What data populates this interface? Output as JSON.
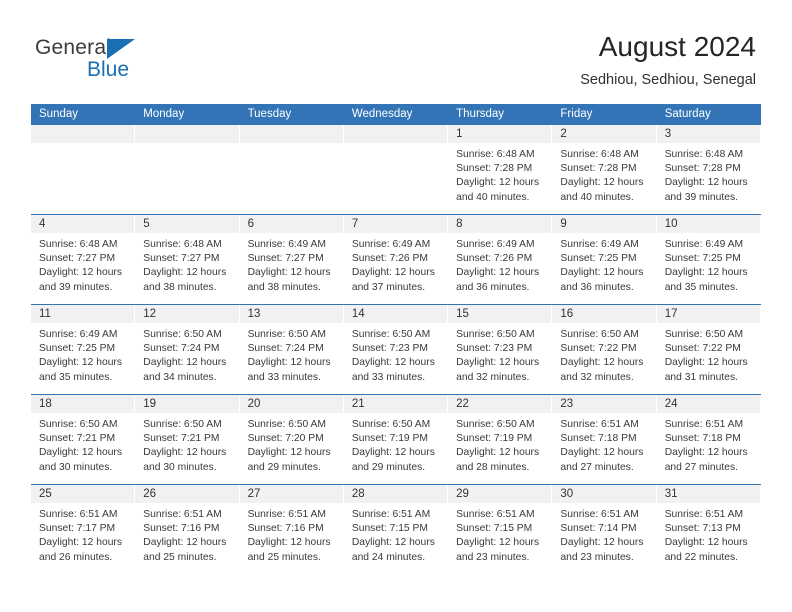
{
  "brand": {
    "word_one": "General",
    "word_two": "Blue",
    "flag_icon": "blue-triangle-flag-icon",
    "accent_color": "#1a6fb5"
  },
  "header": {
    "title": "August 2024",
    "subtitle": "Sedhiou, Sedhiou, Senegal",
    "header_bg_color": "#3274b5",
    "day_band_color": "#f1f1f1"
  },
  "weekday_headers": [
    "Sunday",
    "Monday",
    "Tuesday",
    "Wednesday",
    "Thursday",
    "Friday",
    "Saturday"
  ],
  "labels": {
    "sunrise_prefix": "Sunrise:",
    "sunset_prefix": "Sunset:",
    "daylight_prefix": "Daylight:"
  },
  "weeks": [
    [
      {
        "day": "",
        "empty": true
      },
      {
        "day": "",
        "empty": true
      },
      {
        "day": "",
        "empty": true
      },
      {
        "day": "",
        "empty": true
      },
      {
        "day": "1",
        "sunrise": "Sunrise: 6:48 AM",
        "sunset": "Sunset: 7:28 PM",
        "daylight": "Daylight: 12 hours and 40 minutes."
      },
      {
        "day": "2",
        "sunrise": "Sunrise: 6:48 AM",
        "sunset": "Sunset: 7:28 PM",
        "daylight": "Daylight: 12 hours and 40 minutes."
      },
      {
        "day": "3",
        "sunrise": "Sunrise: 6:48 AM",
        "sunset": "Sunset: 7:28 PM",
        "daylight": "Daylight: 12 hours and 39 minutes."
      }
    ],
    [
      {
        "day": "4",
        "sunrise": "Sunrise: 6:48 AM",
        "sunset": "Sunset: 7:27 PM",
        "daylight": "Daylight: 12 hours and 39 minutes."
      },
      {
        "day": "5",
        "sunrise": "Sunrise: 6:48 AM",
        "sunset": "Sunset: 7:27 PM",
        "daylight": "Daylight: 12 hours and 38 minutes."
      },
      {
        "day": "6",
        "sunrise": "Sunrise: 6:49 AM",
        "sunset": "Sunset: 7:27 PM",
        "daylight": "Daylight: 12 hours and 38 minutes."
      },
      {
        "day": "7",
        "sunrise": "Sunrise: 6:49 AM",
        "sunset": "Sunset: 7:26 PM",
        "daylight": "Daylight: 12 hours and 37 minutes."
      },
      {
        "day": "8",
        "sunrise": "Sunrise: 6:49 AM",
        "sunset": "Sunset: 7:26 PM",
        "daylight": "Daylight: 12 hours and 36 minutes."
      },
      {
        "day": "9",
        "sunrise": "Sunrise: 6:49 AM",
        "sunset": "Sunset: 7:25 PM",
        "daylight": "Daylight: 12 hours and 36 minutes."
      },
      {
        "day": "10",
        "sunrise": "Sunrise: 6:49 AM",
        "sunset": "Sunset: 7:25 PM",
        "daylight": "Daylight: 12 hours and 35 minutes."
      }
    ],
    [
      {
        "day": "11",
        "sunrise": "Sunrise: 6:49 AM",
        "sunset": "Sunset: 7:25 PM",
        "daylight": "Daylight: 12 hours and 35 minutes."
      },
      {
        "day": "12",
        "sunrise": "Sunrise: 6:50 AM",
        "sunset": "Sunset: 7:24 PM",
        "daylight": "Daylight: 12 hours and 34 minutes."
      },
      {
        "day": "13",
        "sunrise": "Sunrise: 6:50 AM",
        "sunset": "Sunset: 7:24 PM",
        "daylight": "Daylight: 12 hours and 33 minutes."
      },
      {
        "day": "14",
        "sunrise": "Sunrise: 6:50 AM",
        "sunset": "Sunset: 7:23 PM",
        "daylight": "Daylight: 12 hours and 33 minutes."
      },
      {
        "day": "15",
        "sunrise": "Sunrise: 6:50 AM",
        "sunset": "Sunset: 7:23 PM",
        "daylight": "Daylight: 12 hours and 32 minutes."
      },
      {
        "day": "16",
        "sunrise": "Sunrise: 6:50 AM",
        "sunset": "Sunset: 7:22 PM",
        "daylight": "Daylight: 12 hours and 32 minutes."
      },
      {
        "day": "17",
        "sunrise": "Sunrise: 6:50 AM",
        "sunset": "Sunset: 7:22 PM",
        "daylight": "Daylight: 12 hours and 31 minutes."
      }
    ],
    [
      {
        "day": "18",
        "sunrise": "Sunrise: 6:50 AM",
        "sunset": "Sunset: 7:21 PM",
        "daylight": "Daylight: 12 hours and 30 minutes."
      },
      {
        "day": "19",
        "sunrise": "Sunrise: 6:50 AM",
        "sunset": "Sunset: 7:21 PM",
        "daylight": "Daylight: 12 hours and 30 minutes."
      },
      {
        "day": "20",
        "sunrise": "Sunrise: 6:50 AM",
        "sunset": "Sunset: 7:20 PM",
        "daylight": "Daylight: 12 hours and 29 minutes."
      },
      {
        "day": "21",
        "sunrise": "Sunrise: 6:50 AM",
        "sunset": "Sunset: 7:19 PM",
        "daylight": "Daylight: 12 hours and 29 minutes."
      },
      {
        "day": "22",
        "sunrise": "Sunrise: 6:50 AM",
        "sunset": "Sunset: 7:19 PM",
        "daylight": "Daylight: 12 hours and 28 minutes."
      },
      {
        "day": "23",
        "sunrise": "Sunrise: 6:51 AM",
        "sunset": "Sunset: 7:18 PM",
        "daylight": "Daylight: 12 hours and 27 minutes."
      },
      {
        "day": "24",
        "sunrise": "Sunrise: 6:51 AM",
        "sunset": "Sunset: 7:18 PM",
        "daylight": "Daylight: 12 hours and 27 minutes."
      }
    ],
    [
      {
        "day": "25",
        "sunrise": "Sunrise: 6:51 AM",
        "sunset": "Sunset: 7:17 PM",
        "daylight": "Daylight: 12 hours and 26 minutes."
      },
      {
        "day": "26",
        "sunrise": "Sunrise: 6:51 AM",
        "sunset": "Sunset: 7:16 PM",
        "daylight": "Daylight: 12 hours and 25 minutes."
      },
      {
        "day": "27",
        "sunrise": "Sunrise: 6:51 AM",
        "sunset": "Sunset: 7:16 PM",
        "daylight": "Daylight: 12 hours and 25 minutes."
      },
      {
        "day": "28",
        "sunrise": "Sunrise: 6:51 AM",
        "sunset": "Sunset: 7:15 PM",
        "daylight": "Daylight: 12 hours and 24 minutes."
      },
      {
        "day": "29",
        "sunrise": "Sunrise: 6:51 AM",
        "sunset": "Sunset: 7:15 PM",
        "daylight": "Daylight: 12 hours and 23 minutes."
      },
      {
        "day": "30",
        "sunrise": "Sunrise: 6:51 AM",
        "sunset": "Sunset: 7:14 PM",
        "daylight": "Daylight: 12 hours and 23 minutes."
      },
      {
        "day": "31",
        "sunrise": "Sunrise: 6:51 AM",
        "sunset": "Sunset: 7:13 PM",
        "daylight": "Daylight: 12 hours and 22 minutes."
      }
    ]
  ]
}
